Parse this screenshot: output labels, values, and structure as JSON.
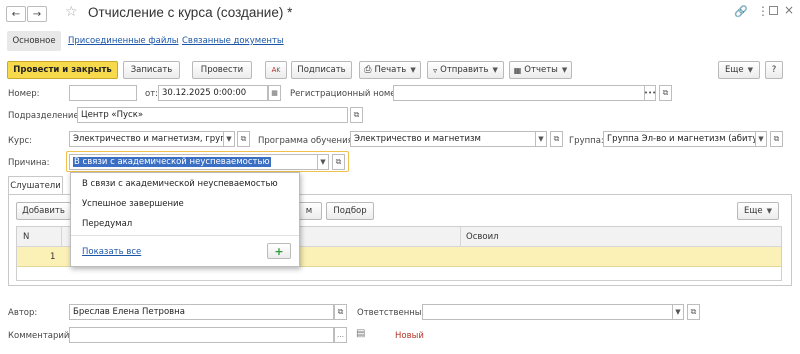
{
  "window": {
    "title": "Отчисление с курса (создание) *"
  },
  "tabs": {
    "main": "Основное",
    "files": "Присоединенные файлы",
    "docs": "Связанные документы"
  },
  "toolbar": {
    "post_close": "Провести и закрыть",
    "save": "Записать",
    "post": "Провести",
    "sign": "Подписать",
    "print": "Печать",
    "send": "Отправить",
    "reports": "Отчеты",
    "more": "Еще"
  },
  "form": {
    "number_label": "Номер:",
    "number_value": "",
    "date_label": "от:",
    "date_value": "30.12.2025  0:00:00",
    "reg_label": "Регистрационный номер:",
    "reg_value": "",
    "division_label": "Подразделение:",
    "division_value": "Центр «Пуск»",
    "course_label": "Курс:",
    "course_value": "Электричество и магнетизм, группа l",
    "program_label": "Программа обучения:",
    "program_value": "Электричество и магнетизм",
    "group_label": "Группа:",
    "group_value": "Группа Эл-во и магнетизм (абитурие",
    "reason_label": "Причина:",
    "reason_value": "В связи с академической неуспеваемостью"
  },
  "dropdown": {
    "options": [
      "В связи с академической неуспеваемостью",
      "Успешное завершение",
      "Передумал"
    ],
    "show_all": "Показать все"
  },
  "students": {
    "tab_label": "Слушатели",
    "add": "Добавить",
    "partial_btn": "м",
    "select": "Подбор",
    "more": "Еще",
    "col_n": "N",
    "col_mastered": "Освоил",
    "rows": [
      {
        "n": "1"
      }
    ]
  },
  "footer": {
    "author_label": "Автор:",
    "author_value": "Бреслав Елена Петровна",
    "responsible_label": "Ответственный:",
    "responsible_value": "",
    "comment_label": "Комментарий:",
    "comment_value": "",
    "status": "Новый"
  },
  "colors": {
    "primary_button": "#f7d94c",
    "selected_row": "#fbf0b5",
    "focus_border": "#f0c14b",
    "status_text": "#b3372b",
    "link": "#1a55a8"
  }
}
